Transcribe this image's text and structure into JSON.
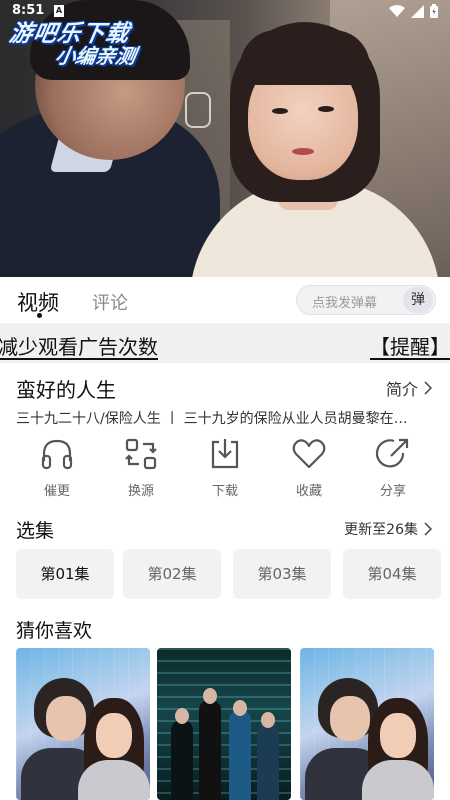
{
  "status_bar": {
    "time": "8:51",
    "notification_icon": "A"
  },
  "watermark": {
    "line1": "游吧乐下载",
    "line2": "小编亲测"
  },
  "tabs": {
    "video": "视频",
    "comment": "评论"
  },
  "danmu": {
    "placeholder": "点我发弹幕",
    "button": "弹"
  },
  "marquee": {
    "text": "减少观看广告次数",
    "tip": "【提醒】"
  },
  "show": {
    "title": "蛮好的人生",
    "intro_label": "简介",
    "description": "三十九二十八/保险人生 丨 三十九岁的保险从业人员胡曼黎在…"
  },
  "actions": [
    {
      "label": "催更",
      "icon": "headphones-icon"
    },
    {
      "label": "换源",
      "icon": "switch-source-icon"
    },
    {
      "label": "下载",
      "icon": "download-icon"
    },
    {
      "label": "收藏",
      "icon": "heart-icon"
    },
    {
      "label": "分享",
      "icon": "share-icon"
    }
  ],
  "episodes": {
    "section_title": "选集",
    "update_text": "更新至26集",
    "items": [
      "第01集",
      "第02集",
      "第03集",
      "第04集"
    ],
    "active_index": 0
  },
  "recommend": {
    "section_title": "猜你喜欢"
  },
  "colors": {
    "accent_text": "#111111",
    "secondary_text": "#8a8a8a",
    "icon_stroke": "#555555",
    "chip_bg": "#f2f2f4",
    "watermark_outline": "#0a3b9a"
  }
}
